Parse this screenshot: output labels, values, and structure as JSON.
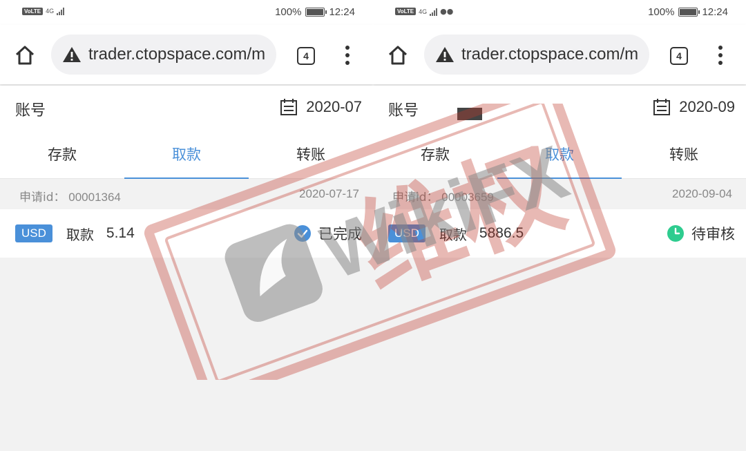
{
  "screens": [
    {
      "status": {
        "network": "4G",
        "battery": "100%",
        "time": "12:24",
        "wechat": false
      },
      "browser": {
        "url": "trader.ctopspace.com/m",
        "tab_count": "4"
      },
      "account_label": "账号",
      "date": "2020-07",
      "tabs": [
        "存款",
        "取款",
        "转账"
      ],
      "active_tab": 1,
      "record": {
        "id_label": "申请id：",
        "id_value": "00001364",
        "date": "2020-07-17",
        "currency": "USD",
        "type": "取款",
        "amount": "5.14",
        "status": "已完成",
        "status_icon": "check-circle-icon",
        "status_color": "#4a90d9"
      }
    },
    {
      "status": {
        "network": "4G",
        "battery": "100%",
        "time": "12:24",
        "wechat": true
      },
      "browser": {
        "url": "trader.ctopspace.com/m",
        "tab_count": "4"
      },
      "account_label": "账号",
      "date": "2020-09",
      "tabs": [
        "存款",
        "取款",
        "转账"
      ],
      "active_tab": 1,
      "record": {
        "id_label": "申请id：",
        "id_value": "00003659",
        "date": "2020-09-04",
        "currency": "USD",
        "type": "取款",
        "amount": "5886.5",
        "status": "待审核",
        "status_icon": "clock-icon",
        "status_color": "#2ecc8f"
      }
    }
  ],
  "watermark": {
    "text": "WikiFX",
    "stamp_text": "维权"
  },
  "colors": {
    "accent": "#4a90d9",
    "pending": "#2ecc8f",
    "stamp": "#c0392b"
  }
}
